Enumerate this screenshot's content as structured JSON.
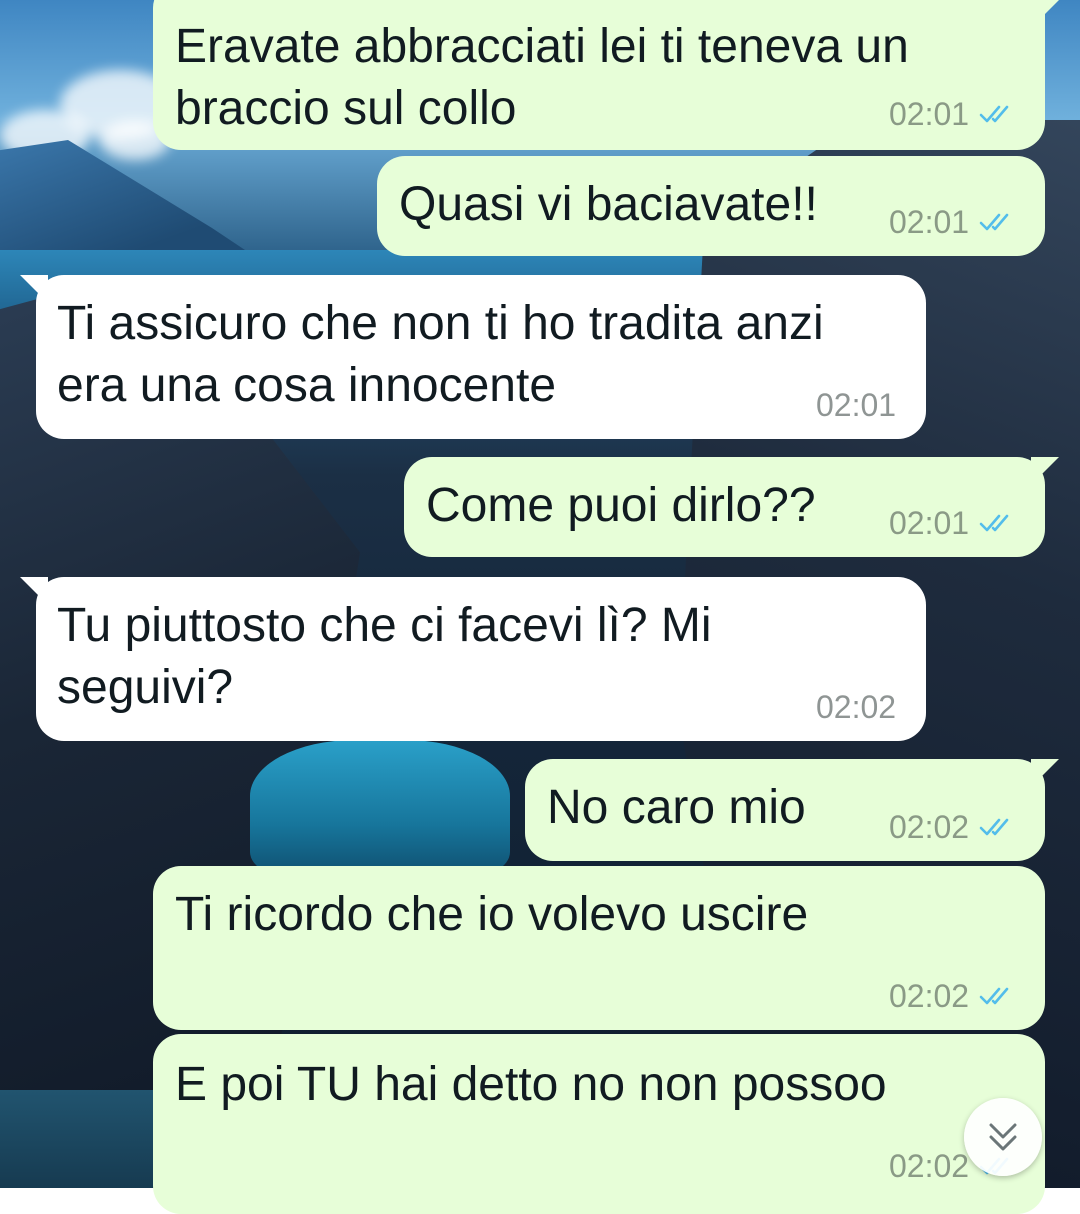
{
  "chat": {
    "messages": [
      {
        "direction": "outgoing",
        "text": "Eravate abbracciati lei ti teneva un\nbraccio sul collo",
        "time": "02:01",
        "status": "read"
      },
      {
        "direction": "outgoing",
        "text": "Quasi vi baciavate!!",
        "time": "02:01",
        "status": "read"
      },
      {
        "direction": "incoming",
        "text": "Ti assicuro che non ti ho tradita anzi\nera una cosa innocente",
        "time": "02:01"
      },
      {
        "direction": "outgoing",
        "text": "Come puoi dirlo??",
        "time": "02:01",
        "status": "read"
      },
      {
        "direction": "incoming",
        "text": "Tu piuttosto che ci facevi lì? Mi\nseguivi?",
        "time": "02:02"
      },
      {
        "direction": "outgoing",
        "text": "No caro mio",
        "time": "02:02",
        "status": "read"
      },
      {
        "direction": "outgoing",
        "text": "Ti ricordo che io volevo uscire",
        "time": "02:02",
        "status": "read"
      },
      {
        "direction": "outgoing",
        "text": "E poi TU hai detto no non possoo",
        "time": "02:02",
        "status": "read"
      }
    ]
  },
  "icons": {
    "read_receipt": "double-check-icon",
    "scroll_down": "double-chevron-down-icon"
  },
  "colors": {
    "outgoing_bubble": "#e7fed8",
    "incoming_bubble": "#ffffff",
    "read_ticks": "#53bdeb",
    "timestamp": "#8a9a86"
  }
}
